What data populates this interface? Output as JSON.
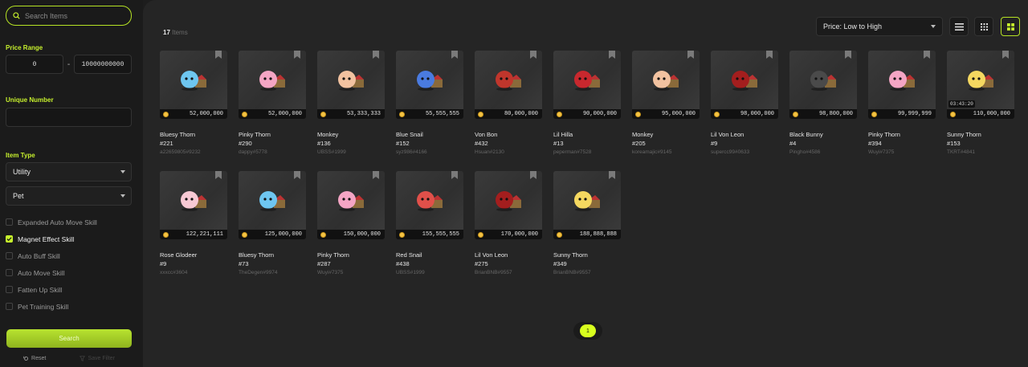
{
  "sidebar": {
    "search_placeholder": "Search Items",
    "price_range_label": "Price Range",
    "price_min": "0",
    "price_max": "10000000000",
    "price_separator": "-",
    "unique_number_label": "Unique Number",
    "unique_number_value": "",
    "item_type_label": "Item Type",
    "item_type_selected": "Utility",
    "sub_type_selected": "Pet",
    "skills": [
      {
        "label": "Expanded Auto Move Skill",
        "checked": false
      },
      {
        "label": "Magnet Effect Skill",
        "checked": true
      },
      {
        "label": "Auto Buff Skill",
        "checked": false
      },
      {
        "label": "Auto Move Skill",
        "checked": false
      },
      {
        "label": "Fatten Up Skill",
        "checked": false
      },
      {
        "label": "Pet Training Skill",
        "checked": false
      }
    ],
    "search_button": "Search",
    "reset_label": "Reset",
    "save_filter_label": "Save Filter"
  },
  "toolbar": {
    "count": "17",
    "count_suffix": "Items",
    "sort_selected": "Price: Low to High"
  },
  "items": [
    {
      "name": "Bluesy Thorn",
      "num": "#221",
      "seller": "a22659805#9232",
      "price": "52,000,000",
      "color": "#6ec6f0",
      "timer": ""
    },
    {
      "name": "Pinky Thorn",
      "num": "#290",
      "seller": "dappy#5778",
      "price": "52,000,000",
      "color": "#f4a5c4",
      "timer": ""
    },
    {
      "name": "Monkey",
      "num": "#136",
      "seller": "UBSS#1999",
      "price": "53,333,333",
      "color": "#f2c2a0",
      "timer": ""
    },
    {
      "name": "Blue Snail",
      "num": "#152",
      "seller": "syz986#4166",
      "price": "55,555,555",
      "color": "#4a7be0",
      "timer": ""
    },
    {
      "name": "Von Bon",
      "num": "#432",
      "seller": "Hsuan#2130",
      "price": "80,000,000",
      "color": "#c0362c",
      "timer": ""
    },
    {
      "name": "Lil Hilla",
      "num": "#13",
      "seller": "peperman#7528",
      "price": "90,000,000",
      "color": "#c8282e",
      "timer": ""
    },
    {
      "name": "Monkey",
      "num": "#205",
      "seller": "koreamajic#9145",
      "price": "95,000,000",
      "color": "#f2c2a0",
      "timer": ""
    },
    {
      "name": "Lil Von Leon",
      "num": "#9",
      "seller": "supercc99#0633",
      "price": "98,000,000",
      "color": "#a31e1e",
      "timer": ""
    },
    {
      "name": "Black Bunny",
      "num": "#4",
      "seller": "Pingho#4586",
      "price": "98,800,000",
      "color": "#4a4a4a",
      "timer": ""
    },
    {
      "name": "Pinky Thorn",
      "num": "#394",
      "seller": "Wuyi#7375",
      "price": "99,999,999",
      "color": "#f4a5c4",
      "timer": ""
    },
    {
      "name": "Sunny Thorn",
      "num": "#153",
      "seller": "TKRT#4841",
      "price": "110,000,000",
      "color": "#f5d860",
      "timer": "03:43:20"
    },
    {
      "name": "Rose Glodeer",
      "num": "#9",
      "seller": "xxxcc#3604",
      "price": "122,221,111",
      "color": "#f7c9d4",
      "timer": ""
    },
    {
      "name": "Bluesy Thorn",
      "num": "#73",
      "seller": "TheDegen#9974",
      "price": "125,000,000",
      "color": "#6ec6f0",
      "timer": ""
    },
    {
      "name": "Pinky Thorn",
      "num": "#287",
      "seller": "Wuyi#7375",
      "price": "150,000,000",
      "color": "#f4a5c4",
      "timer": ""
    },
    {
      "name": "Red Snail",
      "num": "#438",
      "seller": "UBSS#1999",
      "price": "155,555,555",
      "color": "#e0504a",
      "timer": ""
    },
    {
      "name": "Lil Von Leon",
      "num": "#275",
      "seller": "BrianBNB#9557",
      "price": "170,000,000",
      "color": "#a31e1e",
      "timer": ""
    },
    {
      "name": "Sunny Thorn",
      "num": "#349",
      "seller": "BrianBNB#9557",
      "price": "188,888,888",
      "color": "#f5d860",
      "timer": ""
    }
  ],
  "pagination": {
    "current": "1"
  }
}
